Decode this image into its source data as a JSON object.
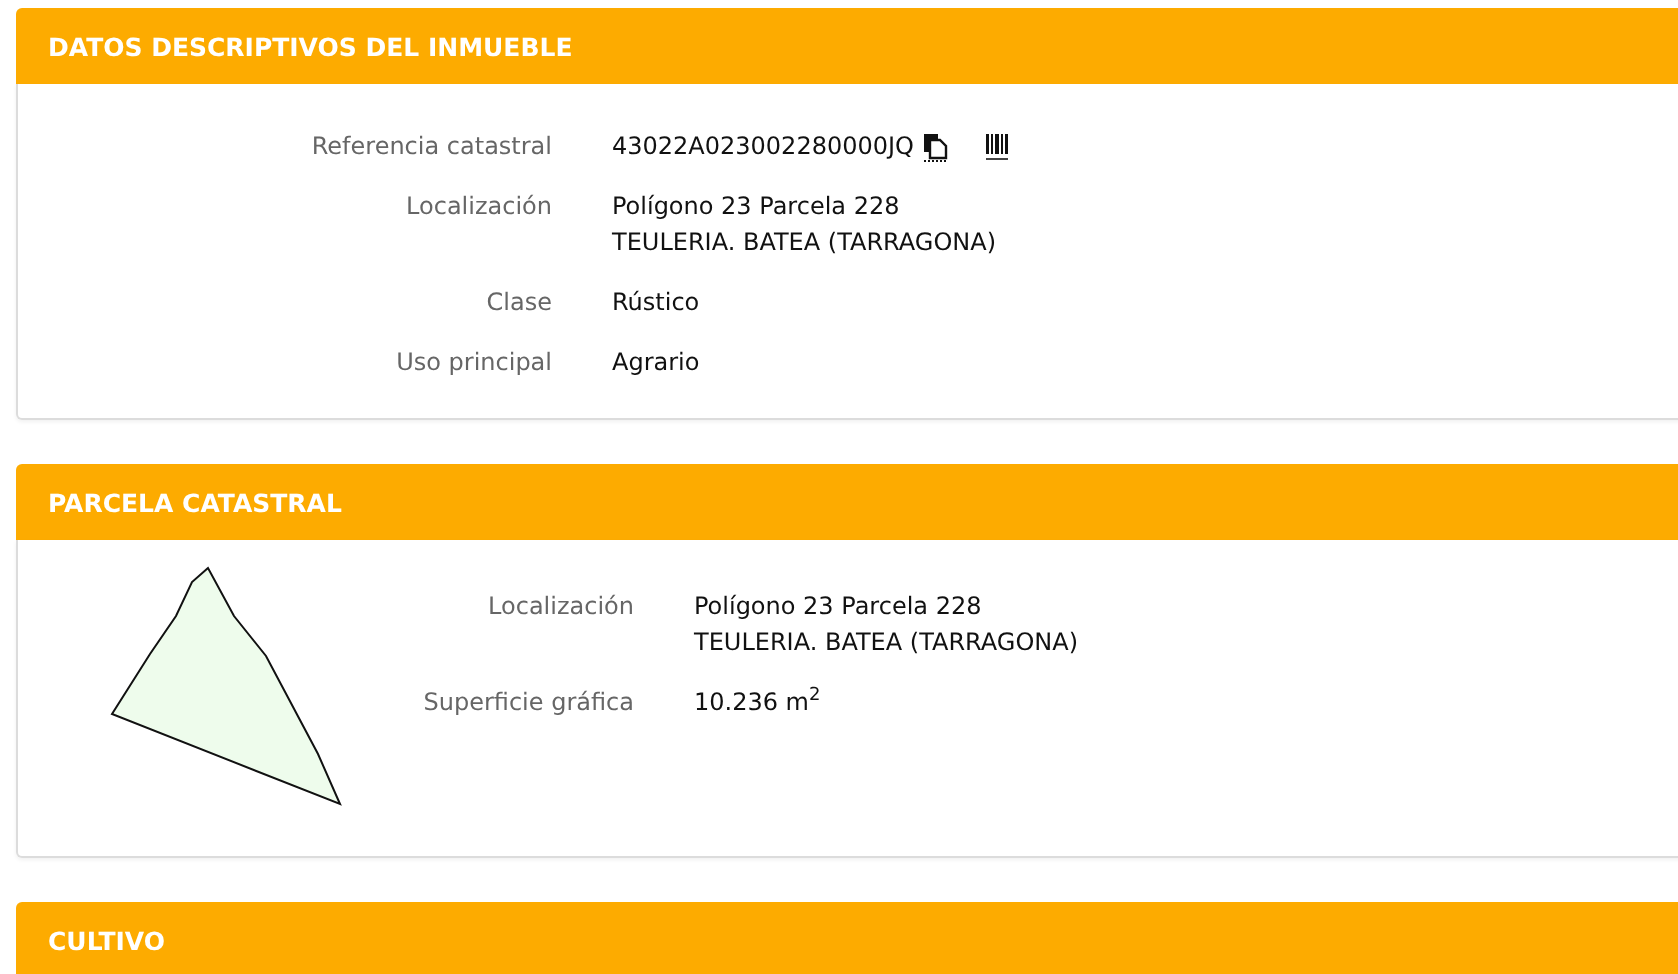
{
  "sections": [
    {
      "kind": "details",
      "title": "DATOS DESCRIPTIVOS DEL INMUEBLE",
      "rows": [
        {
          "kind": "reference",
          "label": "Referencia catastral",
          "lines": [
            "43022A023002280000JQ"
          ]
        },
        {
          "kind": "text",
          "label": "Localización",
          "lines": [
            "Polígono 23 Parcela 228",
            "TEULERIA. BATEA (TARRAGONA)"
          ]
        },
        {
          "kind": "text",
          "label": "Clase",
          "lines": [
            "Rústico"
          ]
        },
        {
          "kind": "text",
          "label": "Uso principal",
          "lines": [
            "Agrario"
          ]
        }
      ]
    },
    {
      "kind": "parcel",
      "title": "PARCELA CATASTRAL",
      "rows": [
        {
          "kind": "text",
          "label": "Localización",
          "lines": [
            "Polígono 23 Parcela 228",
            "TEULERIA. BATEA (TARRAGONA)"
          ]
        },
        {
          "kind": "text",
          "label": "Superficie gráfica",
          "lines": [
            "10.236 m$^{2}$"
          ]
        }
      ]
    },
    {
      "kind": "title_only",
      "title": "CULTIVO"
    }
  ]
}
